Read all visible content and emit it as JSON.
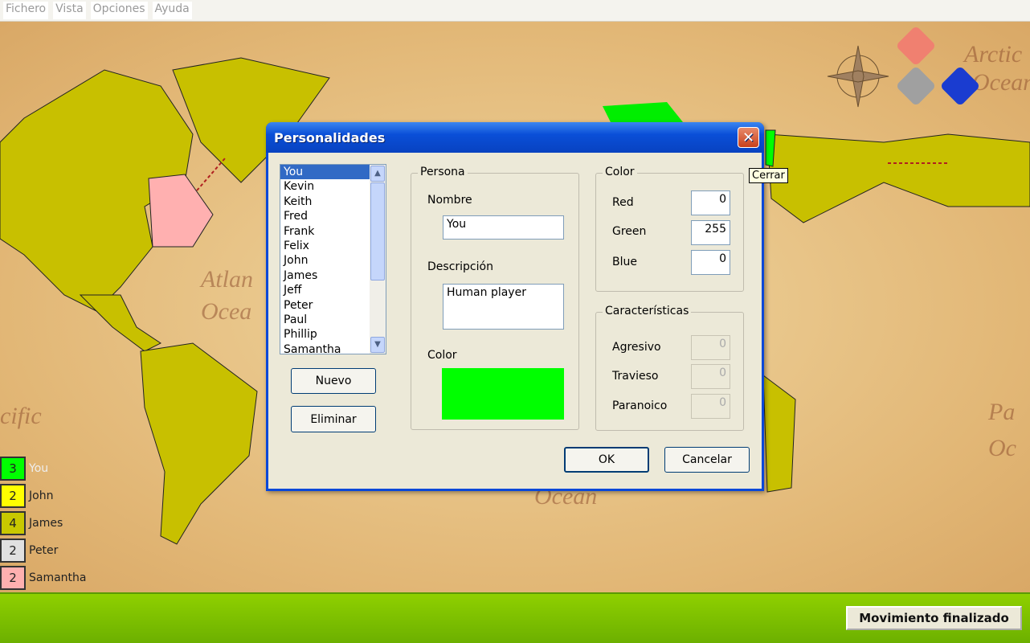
{
  "menu": [
    "Fichero",
    "Vista",
    "Opciones",
    "Ayuda"
  ],
  "legend": [
    {
      "count": "3",
      "name": "You",
      "color": "#00ff00"
    },
    {
      "count": "2",
      "name": "John",
      "color": "#ffff00"
    },
    {
      "count": "4",
      "name": "James",
      "color": "#c8c800"
    },
    {
      "count": "2",
      "name": "Peter",
      "color": "#e0e0e0"
    },
    {
      "count": "2",
      "name": "Samantha",
      "color": "#ffb0b0"
    }
  ],
  "end_turn_label": "Movimiento finalizado",
  "dialog": {
    "title": "Personalidades",
    "close_tooltip": "Cerrar",
    "list": [
      "You",
      "Kevin",
      "Keith",
      "Fred",
      "Frank",
      "Felix",
      "John",
      "James",
      "Jeff",
      "Peter",
      "Paul",
      "Phillip",
      "Samantha"
    ],
    "selected": "You",
    "new_label": "Nuevo",
    "delete_label": "Eliminar",
    "persona": {
      "group": "Persona",
      "name_label": "Nombre",
      "name_value": "You",
      "desc_label": "Descripción",
      "desc_value": "Human player",
      "color_label": "Color",
      "color_value": "#00ff00"
    },
    "color": {
      "group": "Color",
      "red_label": "Red",
      "red": "0",
      "green_label": "Green",
      "green": "255",
      "blue_label": "Blue",
      "blue": "0"
    },
    "traits": {
      "group": "Características",
      "aggressive_label": "Agresivo",
      "aggressive": "0",
      "mischievous_label": "Travieso",
      "mischievous": "0",
      "paranoid_label": "Paranoico",
      "paranoid": "0"
    },
    "ok_label": "OK",
    "cancel_label": "Cancelar"
  }
}
